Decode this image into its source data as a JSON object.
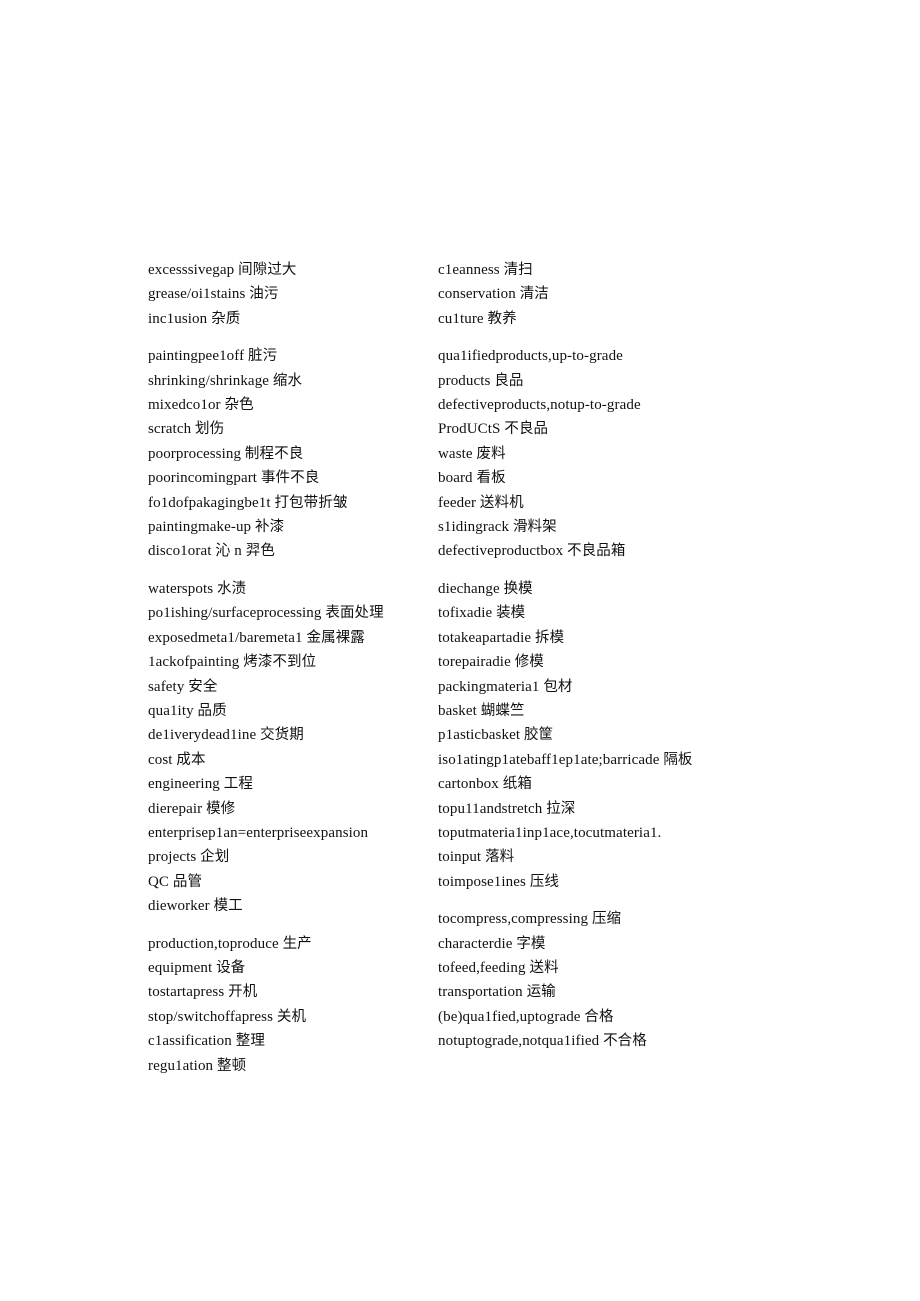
{
  "document": {
    "type": "scanned-bilingual-glossary",
    "language_pair": "English-Chinese",
    "background_color": "#ffffff",
    "text_color": "#111111"
  },
  "glossary": {
    "left_column": [
      {
        "group_id": "defects-1",
        "entries": [
          {
            "en": "excesssivegap ",
            "cn": "间隙过大"
          },
          {
            "en": "grease/oi1stains ",
            "cn": "油污"
          },
          {
            "en": "inc1usion ",
            "cn": "杂质"
          }
        ]
      },
      {
        "group_id": "defects-2",
        "entries": [
          {
            "en": "paintingpee1off ",
            "cn": "脏污"
          },
          {
            "en": "shrinking/shrinkage ",
            "cn": "缩水"
          },
          {
            "en": "mixedco1or ",
            "cn": "杂色"
          },
          {
            "en": "scratch ",
            "cn": "划伤"
          },
          {
            "en": "poorprocessing ",
            "cn": "制程不良"
          },
          {
            "en": "poorincomingpart ",
            "cn": "事件不良"
          },
          {
            "en": "fo1dofpakagingbe1t ",
            "cn": "打包带折皱"
          },
          {
            "en": "paintingmake-up ",
            "cn": "补漆"
          },
          {
            "en": "disco1orat 沁 n ",
            "cn": "羿色"
          }
        ]
      },
      {
        "group_id": "surface-and-management",
        "entries": [
          {
            "en": "waterspots ",
            "cn": "水渍"
          },
          {
            "en": "po1ishing/surfaceprocessing ",
            "cn": "表面处理"
          },
          {
            "en": "exposedmeta1/baremeta1 ",
            "cn": "金属裸露"
          },
          {
            "en": "1ackofpainting ",
            "cn": "烤漆不到位"
          },
          {
            "en": "safety ",
            "cn": "安全"
          },
          {
            "en": "qua1ity ",
            "cn": "品质"
          },
          {
            "en": "de1iverydead1ine ",
            "cn": "交货期"
          },
          {
            "en": "cost ",
            "cn": "成本"
          },
          {
            "en": "engineering ",
            "cn": "工程"
          },
          {
            "en": "dierepair ",
            "cn": "模修"
          },
          {
            "en": "enterprisep1an=enterpriseexpansion",
            "cn": ""
          },
          {
            "en": "projects ",
            "cn": "企划"
          },
          {
            "en": "QC ",
            "cn": "品管"
          },
          {
            "en": "dieworker ",
            "cn": "模工"
          }
        ]
      },
      {
        "group_id": "production-operations",
        "entries": [
          {
            "en": "production,toproduce ",
            "cn": "生产"
          },
          {
            "en": "equipment ",
            "cn": "设备"
          },
          {
            "en": "tostartapress ",
            "cn": "开机"
          },
          {
            "en": "stop/switchoffapress ",
            "cn": "关机"
          },
          {
            "en": "c1assification ",
            "cn": "整理"
          },
          {
            "en": "regu1ation ",
            "cn": "整顿"
          }
        ]
      }
    ],
    "right_column": [
      {
        "group_id": "5s-terms",
        "entries": [
          {
            "en": "c1eanness ",
            "cn": "清扫"
          },
          {
            "en": "conservation ",
            "cn": "清洁"
          },
          {
            "en": "cu1ture ",
            "cn": "教养"
          }
        ]
      },
      {
        "group_id": "product-grades",
        "entries": [
          {
            "en": "qua1ifiedproducts,up-to-grade",
            "cn": ""
          },
          {
            "en": "products ",
            "cn": "良品"
          },
          {
            "en": "defectiveproducts,notup-to-grade",
            "cn": ""
          },
          {
            "en": "ProdUCtS ",
            "cn": "不良品"
          },
          {
            "en": "waste ",
            "cn": "废料"
          },
          {
            "en": "board ",
            "cn": "看板"
          },
          {
            "en": "feeder ",
            "cn": "送料机"
          },
          {
            "en": "s1idingrack ",
            "cn": "滑料架"
          },
          {
            "en": "defectiveproductbox ",
            "cn": "不良品箱"
          }
        ]
      },
      {
        "group_id": "die-and-containers",
        "entries": [
          {
            "en": "diechange ",
            "cn": "换模"
          },
          {
            "en": "tofixadie ",
            "cn": "装模"
          },
          {
            "en": "totakeapartadie ",
            "cn": "拆模"
          },
          {
            "en": "torepairadie ",
            "cn": "修模"
          },
          {
            "en": "packingmateria1 ",
            "cn": "包材"
          },
          {
            "en": "basket ",
            "cn": "蝴蝶竺"
          },
          {
            "en": "p1asticbasket ",
            "cn": "胶筐"
          },
          {
            "en": "iso1atingp1atebaff1ep1ate;barricade ",
            "cn": "隔板"
          },
          {
            "en": "cartonbox ",
            "cn": "纸箱"
          },
          {
            "en": "topu11andstretch ",
            "cn": "拉深"
          },
          {
            "en": "toputmateria1inp1ace,tocutmateria1.",
            "cn": ""
          },
          {
            "en": "toinput ",
            "cn": "落料"
          },
          {
            "en": "toimpose1ines ",
            "cn": "压线"
          }
        ]
      },
      {
        "group_id": "press-actions",
        "entries": [
          {
            "en": "tocompress,compressing ",
            "cn": "压缩"
          },
          {
            "en": "characterdie ",
            "cn": "字模"
          },
          {
            "en": "tofeed,feeding ",
            "cn": "送料"
          },
          {
            "en": "transportation ",
            "cn": "运输"
          },
          {
            "en": "(be)qua1fied,uptograde ",
            "cn": "合格"
          },
          {
            "en": "notuptograde,notqua1ified ",
            "cn": "不合格"
          }
        ]
      }
    ]
  }
}
